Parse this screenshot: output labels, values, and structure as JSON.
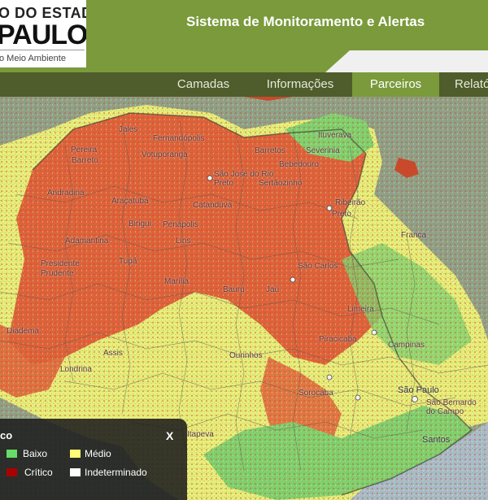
{
  "header": {
    "logo_line1": "O DO ESTADO",
    "logo_line2": "PAULO",
    "logo_line3": "o Meio Ambiente",
    "title": "Sistema de Monitoramento e Alertas"
  },
  "nav": {
    "items": [
      {
        "label": "Camadas"
      },
      {
        "label": "Informações"
      },
      {
        "label": "Parceiros"
      },
      {
        "label": "Relató"
      }
    ],
    "active_index": 2
  },
  "map": {
    "labels": [
      "Jales",
      "Fernandópolis",
      "Votuporanga",
      "Barretos",
      "Bebedouro",
      "Ituverava",
      "Severinia",
      "Pereira",
      "Barreto",
      "São José do Rio Preto",
      "Sertãozinho",
      "Ribeirão",
      "Preto",
      "Franca",
      "Andradina",
      "Araçatuba",
      "Birigui",
      "Penápolis",
      "Catanduva",
      "Adamantina",
      "Lins",
      "Tupã",
      "Presidente Prudente",
      "Marília",
      "Bauru",
      "Jaú",
      "São Carlos",
      "Limeira",
      "Ourinhos",
      "Piracicaba",
      "Campinas",
      "Sorocaba",
      "São Paulo",
      "São Bernardo do Campo",
      "Santos",
      "Londrina",
      "Diadema",
      "Assis",
      "Itapeva"
    ],
    "colors": {
      "critical": "#e0603a",
      "medium": "#e8ee7a",
      "low": "#7fd16f",
      "background": "#8fa08a",
      "sea": "#a8bccc"
    }
  },
  "legend": {
    "title": "co",
    "close_label": "X",
    "items": [
      {
        "label": "Baixo",
        "color": "#66dd66"
      },
      {
        "label": "Médio",
        "color": "#ffff77"
      },
      {
        "label": "Crítico",
        "color": "#aa0000"
      },
      {
        "label": "Indeterminado",
        "color": "#ffffff"
      }
    ]
  }
}
